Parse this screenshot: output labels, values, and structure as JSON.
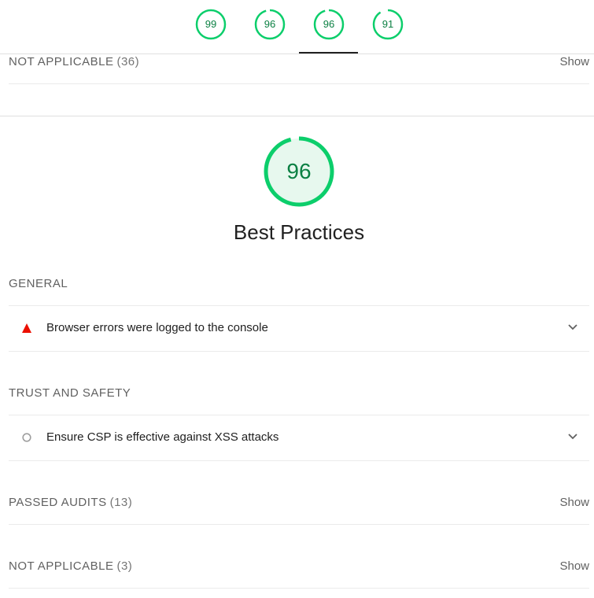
{
  "top_scores": [
    "99",
    "96",
    "96",
    "91"
  ],
  "top_not_applicable": {
    "label": "NOT APPLICABLE",
    "count": "(36)",
    "show": "Show"
  },
  "category": {
    "score": "96",
    "title": "Best Practices"
  },
  "groups": [
    {
      "title": "GENERAL",
      "audits": [
        {
          "title": "Browser errors were logged to the console",
          "status": "fail",
          "icon": "triangle-icon"
        }
      ]
    },
    {
      "title": "TRUST AND SAFETY",
      "audits": [
        {
          "title": "Ensure CSP is effective against XSS attacks",
          "status": "info",
          "icon": "circle-icon"
        }
      ]
    }
  ],
  "passed_audits": {
    "label": "PASSED AUDITS",
    "count": "(13)",
    "show": "Show"
  },
  "not_applicable": {
    "label": "NOT APPLICABLE",
    "count": "(3)",
    "show": "Show"
  },
  "colors": {
    "pass": "#0cce6b",
    "pass_text": "#0b8043",
    "fail": "#eb0f00",
    "neutral": "#9e9e9e"
  }
}
